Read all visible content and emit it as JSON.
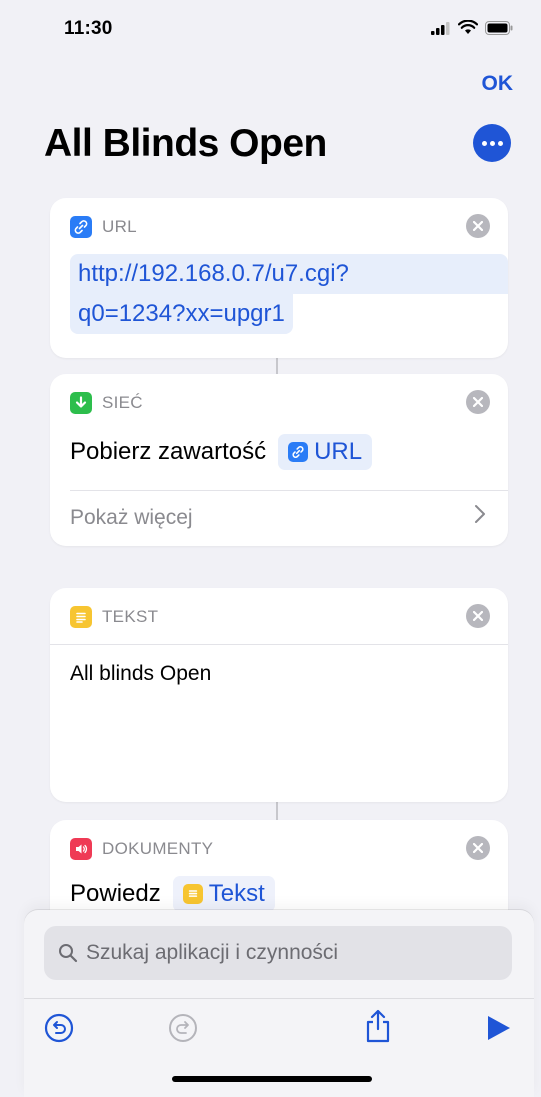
{
  "status": {
    "time": "11:30"
  },
  "header": {
    "ok_label": "OK",
    "title": "All Blinds Open"
  },
  "actions": [
    {
      "category": "URL",
      "url_line1": "http://192.168.0.7/u7.cgi?",
      "url_line2": "q0=1234?xx=upgr1",
      "icon": "link-icon",
      "color": "#2a7cf6"
    },
    {
      "category": "SIEĆ",
      "action": "Pobierz zawartość",
      "variable": "URL",
      "show_more": "Pokaż więcej",
      "icon": "download-icon",
      "color": "#2dbe4c"
    },
    {
      "category": "TEKST",
      "text": "All blinds Open",
      "icon": "text-icon",
      "color": "#f7c531"
    },
    {
      "category": "DOKUMENTY",
      "action": "Powiedz",
      "variable": "Tekst",
      "icon": "speaker-icon",
      "color": "#ef3a55"
    }
  ],
  "search": {
    "placeholder": "Szukaj aplikacji i czynności"
  },
  "toolbar": {
    "undo": "undo-icon",
    "redo": "redo-icon",
    "share": "share-icon",
    "run": "play-icon"
  },
  "colors": {
    "accent": "#1f55d6",
    "background": "#f1f1f6"
  }
}
